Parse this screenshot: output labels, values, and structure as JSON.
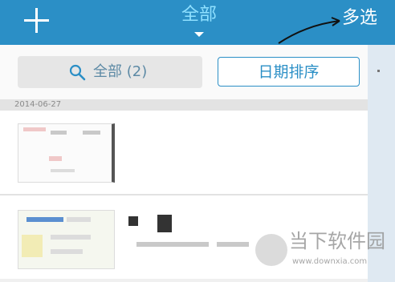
{
  "header": {
    "title": "全部",
    "multi_select_label": "多选"
  },
  "search": {
    "label": "全部 (2)"
  },
  "sort_button": {
    "label": "日期排序"
  },
  "list": {
    "date_header": "2014-06-27"
  },
  "watermark": {
    "brand": "当下软件园",
    "url": "www.downxia.com"
  },
  "colors": {
    "header_bg": "#2b8fc6",
    "title_accent": "#8fe0ff",
    "sort_border": "#2b8fc6"
  }
}
